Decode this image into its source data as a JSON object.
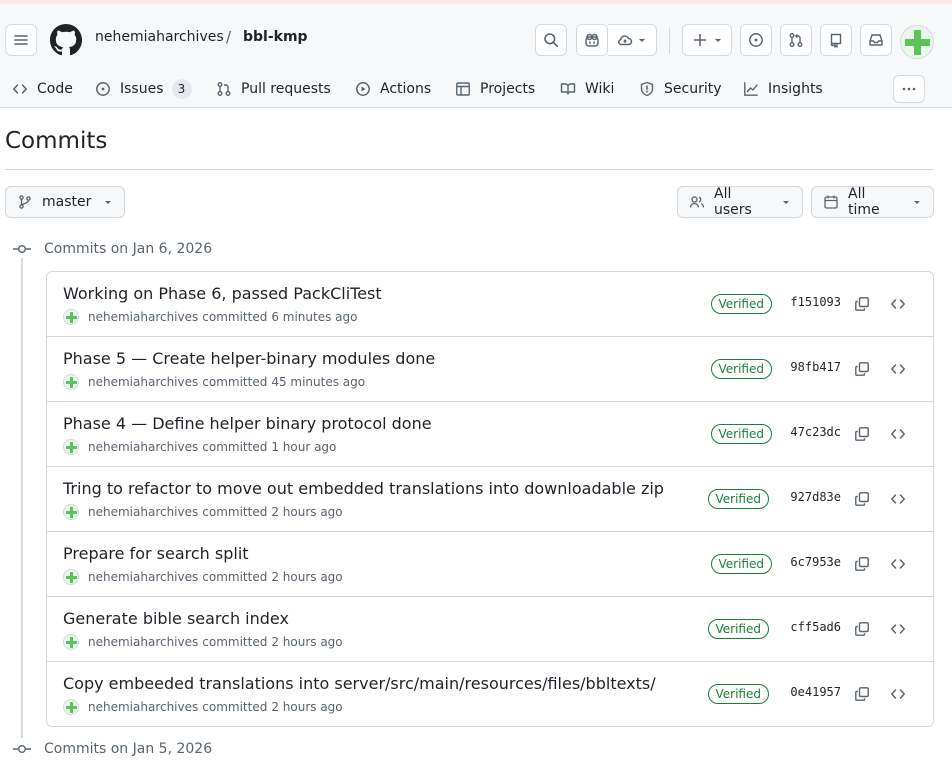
{
  "header": {
    "owner": "nehemiaharchives",
    "separator": "/",
    "repo": "bbl-kmp",
    "icons": [
      "hamburger-icon",
      "github-logo-icon",
      "search-icon",
      "copilot-icon",
      "cloud-icon",
      "plus-icon",
      "issue-opened-icon",
      "git-pull-request-icon",
      "repo-icon",
      "inbox-icon"
    ]
  },
  "nav": {
    "items": [
      {
        "label": "Code",
        "icon": "code-icon"
      },
      {
        "label": "Issues",
        "icon": "issue-opened-icon",
        "count": "3"
      },
      {
        "label": "Pull requests",
        "icon": "git-pull-request-icon"
      },
      {
        "label": "Actions",
        "icon": "play-icon"
      },
      {
        "label": "Projects",
        "icon": "table-icon"
      },
      {
        "label": "Wiki",
        "icon": "book-icon"
      },
      {
        "label": "Security",
        "icon": "shield-icon"
      },
      {
        "label": "Insights",
        "icon": "graph-icon"
      }
    ],
    "more": "…"
  },
  "page": {
    "title": "Commits"
  },
  "filters": {
    "branch": "master",
    "users": "All users",
    "time": "All time"
  },
  "groups": [
    {
      "heading": "Commits on Jan 6, 2026",
      "commits": [
        {
          "message": "Working on Phase 6, passed PackCliTest",
          "author": "nehemiaharchives",
          "verb": "committed",
          "when": "6 minutes ago",
          "badge": "Verified",
          "sha": "f151093"
        },
        {
          "message": "Phase 5 — Create helper-binary modules done",
          "author": "nehemiaharchives",
          "verb": "committed",
          "when": "45 minutes ago",
          "badge": "Verified",
          "sha": "98fb417"
        },
        {
          "message": "Phase 4 — Define helper binary protocol done",
          "author": "nehemiaharchives",
          "verb": "committed",
          "when": "1 hour ago",
          "badge": "Verified",
          "sha": "47c23dc"
        },
        {
          "message": "Tring to refactor to move out embedded translations into downloadable zip",
          "author": "nehemiaharchives",
          "verb": "committed",
          "when": "2 hours ago",
          "badge": "Verified",
          "sha": "927d83e"
        },
        {
          "message": "Prepare for search split",
          "author": "nehemiaharchives",
          "verb": "committed",
          "when": "2 hours ago",
          "badge": "Verified",
          "sha": "6c7953e"
        },
        {
          "message": "Generate bible search index",
          "author": "nehemiaharchives",
          "verb": "committed",
          "when": "2 hours ago",
          "badge": "Verified",
          "sha": "cff5ad6"
        },
        {
          "message": "Copy embeeded translations into server/src/main/resources/files/bbltexts/",
          "author": "nehemiaharchives",
          "verb": "committed",
          "when": "2 hours ago",
          "badge": "Verified",
          "sha": "0e41957"
        }
      ]
    },
    {
      "heading": "Commits on Jan 5, 2026",
      "commits": []
    }
  ],
  "colors": {
    "verified": "#1a7f37",
    "border": "#d1d9e0",
    "muted": "#59636e",
    "avatar": "#5cc25c"
  }
}
